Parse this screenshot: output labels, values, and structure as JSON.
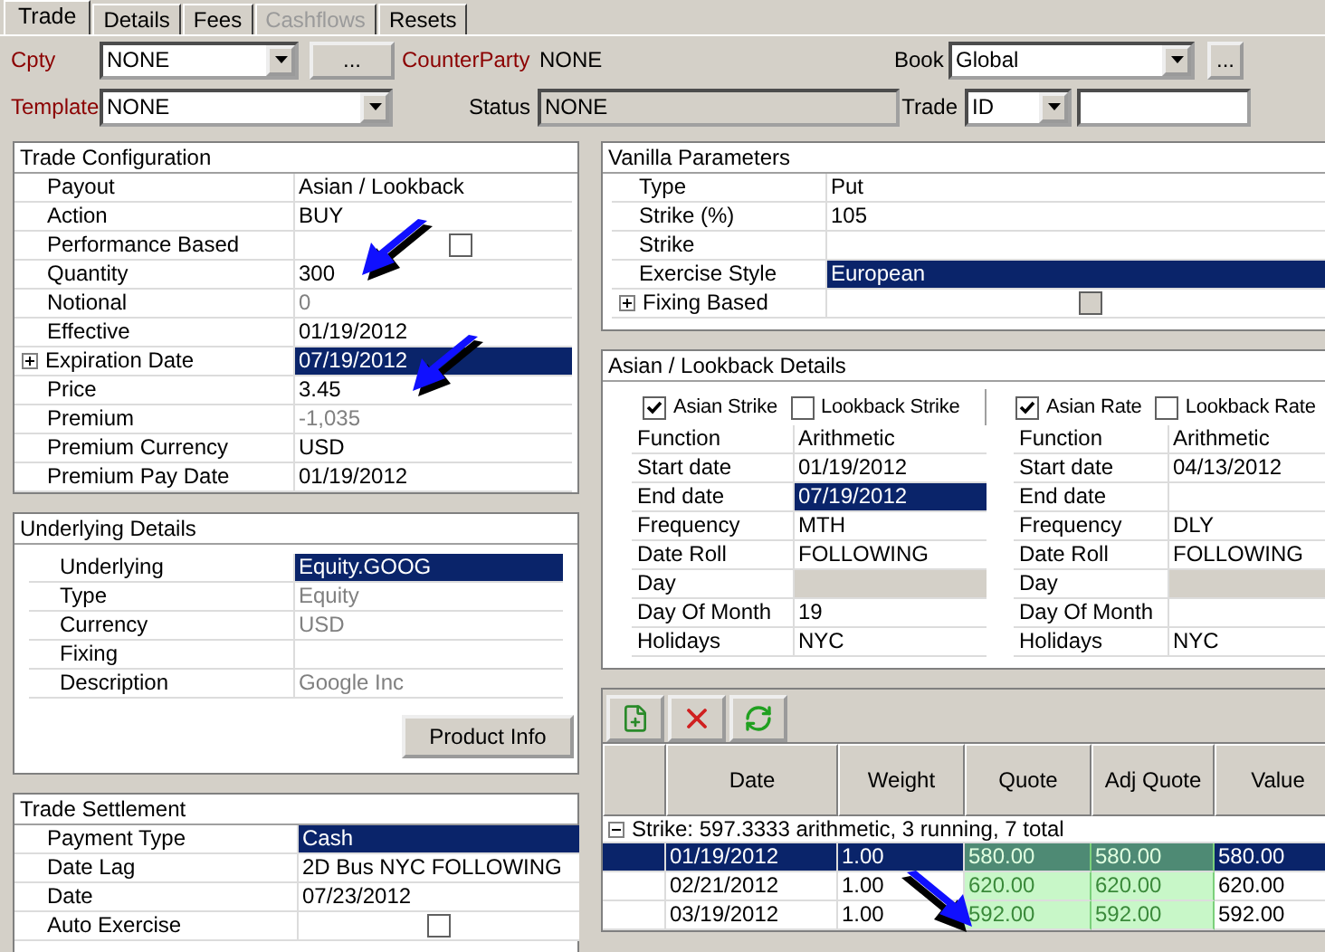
{
  "tabs": [
    {
      "label": "Trade",
      "selected": true,
      "disabled": false
    },
    {
      "label": "Details",
      "selected": false,
      "disabled": false
    },
    {
      "label": "Fees",
      "selected": false,
      "disabled": false
    },
    {
      "label": "Cashflows",
      "selected": false,
      "disabled": true
    },
    {
      "label": "Resets",
      "selected": false,
      "disabled": false
    }
  ],
  "header": {
    "cpty": {
      "label": "Cpty",
      "required": true,
      "value": "NONE",
      "button": "..."
    },
    "counterparty": {
      "label": "CounterParty",
      "required": true,
      "value": "NONE"
    },
    "book": {
      "label": "Book",
      "required": false,
      "value": "Global",
      "button": "..."
    },
    "template": {
      "label": "Template",
      "required": true,
      "value": "NONE"
    },
    "status": {
      "label": "Status",
      "required": false,
      "value": "NONE"
    },
    "trade": {
      "label": "Trade",
      "required": false,
      "value": "ID"
    }
  },
  "trade_configuration": {
    "title": "Trade Configuration",
    "rows": [
      {
        "label": "Payout",
        "value": "Asian / Lookback",
        "kind": "text",
        "selected": false,
        "muted": false,
        "expandable": false
      },
      {
        "label": "Action",
        "value": "BUY",
        "kind": "text",
        "selected": false,
        "muted": false,
        "expandable": false
      },
      {
        "label": "Performance Based",
        "kind": "checkbox",
        "checked": false,
        "selected": false,
        "expandable": false
      },
      {
        "label": "Quantity",
        "value": "300",
        "kind": "text",
        "selected": false,
        "muted": false,
        "expandable": false
      },
      {
        "label": "Notional",
        "value": "0",
        "kind": "text",
        "selected": false,
        "muted": true,
        "expandable": false
      },
      {
        "label": "Effective",
        "value": "01/19/2012",
        "kind": "text",
        "selected": false,
        "muted": false,
        "expandable": false
      },
      {
        "label": "Expiration Date",
        "value": "07/19/2012",
        "kind": "text",
        "selected": true,
        "muted": false,
        "expandable": true
      },
      {
        "label": "Price",
        "value": "3.45",
        "kind": "text",
        "selected": false,
        "muted": false,
        "expandable": false
      },
      {
        "label": "Premium",
        "value": "-1,035",
        "kind": "text",
        "selected": false,
        "muted": true,
        "expandable": false
      },
      {
        "label": "Premium Currency",
        "value": "USD",
        "kind": "text",
        "selected": false,
        "muted": false,
        "expandable": false
      },
      {
        "label": "Premium Pay Date",
        "value": "01/19/2012",
        "kind": "text",
        "selected": false,
        "muted": false,
        "expandable": false
      }
    ]
  },
  "underlying_details": {
    "title": "Underlying Details",
    "rows": [
      {
        "label": "Underlying",
        "value": "Equity.GOOG",
        "kind": "text",
        "selected": true,
        "muted": false
      },
      {
        "label": "Type",
        "value": "Equity",
        "kind": "text",
        "selected": false,
        "muted": true
      },
      {
        "label": "Currency",
        "value": "USD",
        "kind": "text",
        "selected": false,
        "muted": true
      },
      {
        "label": "Fixing",
        "kind": "text",
        "selected": false
      },
      {
        "label": "Description",
        "value": "Google Inc",
        "kind": "text",
        "selected": false,
        "muted": true
      }
    ],
    "button": "Product Info"
  },
  "trade_settlement": {
    "title": "Trade Settlement",
    "rows": [
      {
        "label": "Payment Type",
        "value": "Cash",
        "kind": "text",
        "selected": true,
        "muted": false
      },
      {
        "label": "Date Lag",
        "value": "2D Bus NYC FOLLOWING",
        "kind": "text",
        "selected": false,
        "muted": false
      },
      {
        "label": "Date",
        "value": "07/23/2012",
        "kind": "text",
        "selected": false,
        "muted": false
      },
      {
        "label": "Auto Exercise",
        "kind": "checkbox",
        "checked": false,
        "selected": false
      }
    ]
  },
  "vanilla_parameters": {
    "title": "Vanilla Parameters",
    "rows": [
      {
        "label": "Type",
        "value": "Put",
        "kind": "text",
        "selected": false,
        "muted": false,
        "expandable": false
      },
      {
        "label": "Strike (%)",
        "value": "105",
        "kind": "text",
        "selected": false,
        "muted": false,
        "expandable": false
      },
      {
        "label": "Strike",
        "kind": "text",
        "selected": false,
        "expandable": false
      },
      {
        "label": "Exercise Style",
        "value": "European",
        "kind": "text",
        "selected": true,
        "muted": false,
        "expandable": false
      },
      {
        "label": "Fixing Based",
        "kind": "checkbox",
        "checked": false,
        "disabled": true,
        "selected": false,
        "expandable": true
      }
    ]
  },
  "asian_lookback_details": {
    "title": "Asian / Lookback Details",
    "sections": [
      {
        "options": [
          {
            "label": "Asian Strike",
            "checked": true
          },
          {
            "label": "Lookback Strike",
            "checked": false
          }
        ],
        "rows": [
          {
            "label": "Function",
            "value": "Arithmetic",
            "selected": false,
            "disabled": false
          },
          {
            "label": "Start date",
            "value": "01/19/2012",
            "selected": false,
            "disabled": false
          },
          {
            "label": "End date",
            "value": "07/19/2012",
            "selected": true,
            "disabled": false
          },
          {
            "label": "Frequency",
            "value": "MTH",
            "selected": false,
            "disabled": false
          },
          {
            "label": "Date Roll",
            "value": "FOLLOWING",
            "selected": false,
            "disabled": false
          },
          {
            "label": "Day",
            "selected": false,
            "disabled": true
          },
          {
            "label": "Day Of Month",
            "value": "19",
            "selected": false,
            "disabled": false
          },
          {
            "label": "Holidays",
            "value": "NYC",
            "selected": false,
            "disabled": false
          }
        ]
      },
      {
        "options": [
          {
            "label": "Asian Rate",
            "checked": true
          },
          {
            "label": "Lookback Rate",
            "checked": false
          }
        ],
        "rows": [
          {
            "label": "Function",
            "value": "Arithmetic",
            "selected": false,
            "disabled": false
          },
          {
            "label": "Start date",
            "value": "04/13/2012",
            "selected": false,
            "disabled": false
          },
          {
            "label": "End date",
            "selected": false,
            "disabled": false
          },
          {
            "label": "Frequency",
            "value": "DLY",
            "selected": false,
            "disabled": false
          },
          {
            "label": "Date Roll",
            "value": "FOLLOWING",
            "selected": false,
            "disabled": false
          },
          {
            "label": "Day",
            "selected": false,
            "disabled": true
          },
          {
            "label": "Day Of Month",
            "selected": false,
            "disabled": false
          },
          {
            "label": "Holidays",
            "value": "NYC",
            "selected": false,
            "disabled": false
          }
        ]
      }
    ]
  },
  "fixings": {
    "columns": [
      {
        "label": "Date",
        "highlighted": false
      },
      {
        "label": "Weight",
        "highlighted": false
      },
      {
        "label": "Quote",
        "highlighted": true
      },
      {
        "label": "Adj Quote",
        "highlighted": true
      },
      {
        "label": "Value",
        "highlighted": false
      }
    ],
    "group": {
      "label": "Strike: 597.3333 arithmetic, 3 running, 7 total",
      "expanded": true
    },
    "rows": [
      {
        "cells": [
          "01/19/2012",
          "1.00",
          "580.00",
          "580.00",
          "580.00"
        ],
        "selected": true
      },
      {
        "cells": [
          "02/21/2012",
          "1.00",
          "620.00",
          "620.00",
          "620.00"
        ],
        "selected": false
      },
      {
        "cells": [
          "03/19/2012",
          "1.00",
          "592.00",
          "592.00",
          "592.00"
        ],
        "selected": false
      }
    ]
  }
}
